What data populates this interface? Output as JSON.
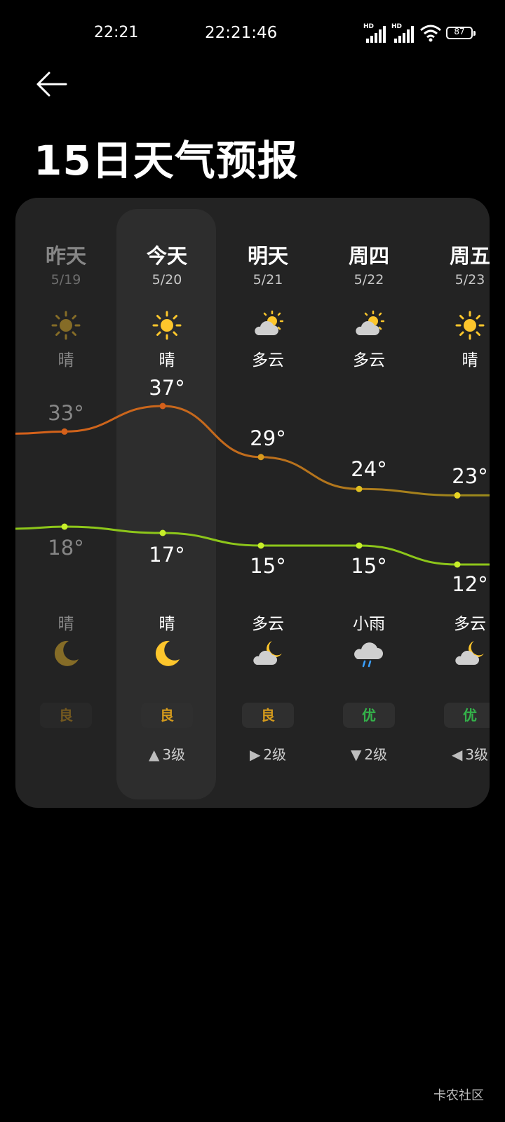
{
  "status": {
    "time": "22:21",
    "clock": "22:21:46",
    "signal1_badge": "HD",
    "signal2_badge": "HD",
    "battery": "87"
  },
  "page": {
    "title": "15日天气预报"
  },
  "colors": {
    "high_curve_warm": "#d5601a",
    "high_curve_cool": "#b0901c",
    "low_curve": "#8dc61a",
    "aqi_good": "#d49a1c",
    "aqi_excellent": "#34b24a",
    "sun": "#fdc62c"
  },
  "days": [
    {
      "name": "昨天",
      "date": "5/19",
      "icon_day": "sun-icon",
      "desc_day": "晴",
      "high": "33°",
      "high_value": 33,
      "low": "18°",
      "low_value": 18,
      "desc_night": "晴",
      "icon_night": "moon-icon",
      "aqi": "良",
      "aqi_level": "good",
      "wind_dir": "",
      "wind": ""
    },
    {
      "name": "今天",
      "date": "5/20",
      "icon_day": "sun-icon",
      "desc_day": "晴",
      "high": "37°",
      "high_value": 37,
      "low": "17°",
      "low_value": 17,
      "desc_night": "晴",
      "icon_night": "moon-icon",
      "aqi": "良",
      "aqi_level": "good",
      "wind_dir": "up",
      "wind": "3级"
    },
    {
      "name": "明天",
      "date": "5/21",
      "icon_day": "partly-cloudy-icon",
      "desc_day": "多云",
      "high": "29°",
      "high_value": 29,
      "low": "15°",
      "low_value": 15,
      "desc_night": "多云",
      "icon_night": "cloudy-night-icon",
      "aqi": "良",
      "aqi_level": "good",
      "wind_dir": "right",
      "wind": "2级"
    },
    {
      "name": "周四",
      "date": "5/22",
      "icon_day": "partly-cloudy-icon",
      "desc_day": "多云",
      "high": "24°",
      "high_value": 24,
      "low": "15°",
      "low_value": 15,
      "desc_night": "小雨",
      "icon_night": "rain-icon",
      "aqi": "优",
      "aqi_level": "excellent",
      "wind_dir": "down",
      "wind": "2级"
    },
    {
      "name": "周五",
      "date": "5/23",
      "icon_day": "sun-icon",
      "desc_day": "晴",
      "high": "23°",
      "high_value": 23,
      "low": "12°",
      "low_value": 12,
      "desc_night": "多云",
      "icon_night": "cloudy-night-icon",
      "aqi": "优",
      "aqi_level": "excellent",
      "wind_dir": "left",
      "wind": "3级"
    }
  ],
  "footer": {
    "watermark": "卡农社区"
  }
}
